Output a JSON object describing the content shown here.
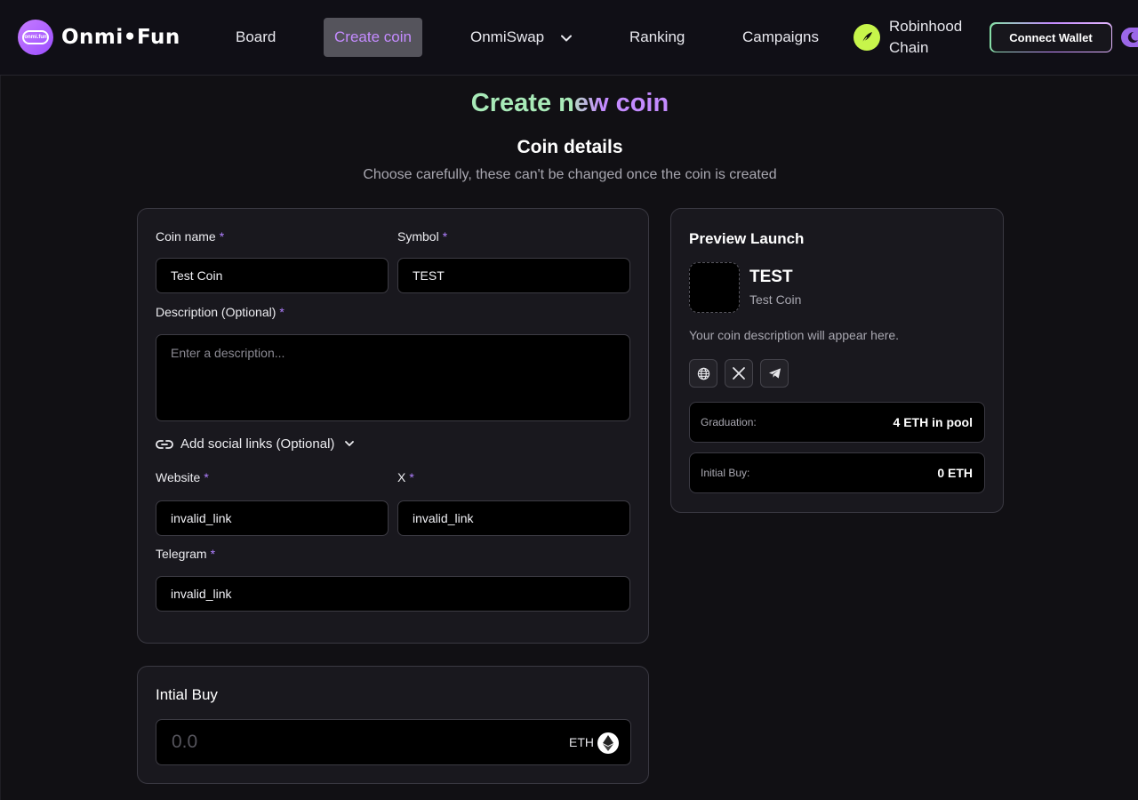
{
  "header": {
    "logo_text": "Onmi•Fun",
    "logo_badge_text": "onmi.fun",
    "nav": {
      "board": "Board",
      "create_coin": "Create coin",
      "onmiswap": "OnmiSwap",
      "ranking": "Ranking",
      "campaigns": "Campaigns"
    },
    "chain_label": "Robinhood Chain",
    "connect_wallet": "Connect Wallet"
  },
  "page": {
    "title_part1": "Create n",
    "title_part2": "ew coin",
    "section_title": "Coin details",
    "section_subtitle": "Choose carefully, these can't be changed once the coin is created"
  },
  "form": {
    "required_mark": "*",
    "coin_name_label": "Coin name",
    "coin_name_value": "Test Coin",
    "symbol_label": "Symbol",
    "symbol_value": "TEST",
    "description_label": "Description (Optional)",
    "description_placeholder": "Enter a description...",
    "social_toggle": "Add social links (Optional)",
    "website_label": "Website",
    "website_value": "invalid_link",
    "x_label": "X",
    "x_value": "invalid_link",
    "telegram_label": "Telegram",
    "telegram_value": "invalid_link"
  },
  "preview": {
    "title": "Preview Launch",
    "symbol": "TEST",
    "name": "Test Coin",
    "description": "Your coin description will appear here.",
    "graduation_label": "Graduation:",
    "graduation_value": "4 ETH in pool",
    "initial_buy_label": "Initial Buy:",
    "initial_buy_value": "0 ETH"
  },
  "initial_buy": {
    "title": "Intial Buy",
    "placeholder": "0.0",
    "unit": "ETH"
  },
  "colors": {
    "accent": "#c48bff",
    "background": "#111014",
    "card": "#19181e",
    "chain": "#c7f54b"
  }
}
